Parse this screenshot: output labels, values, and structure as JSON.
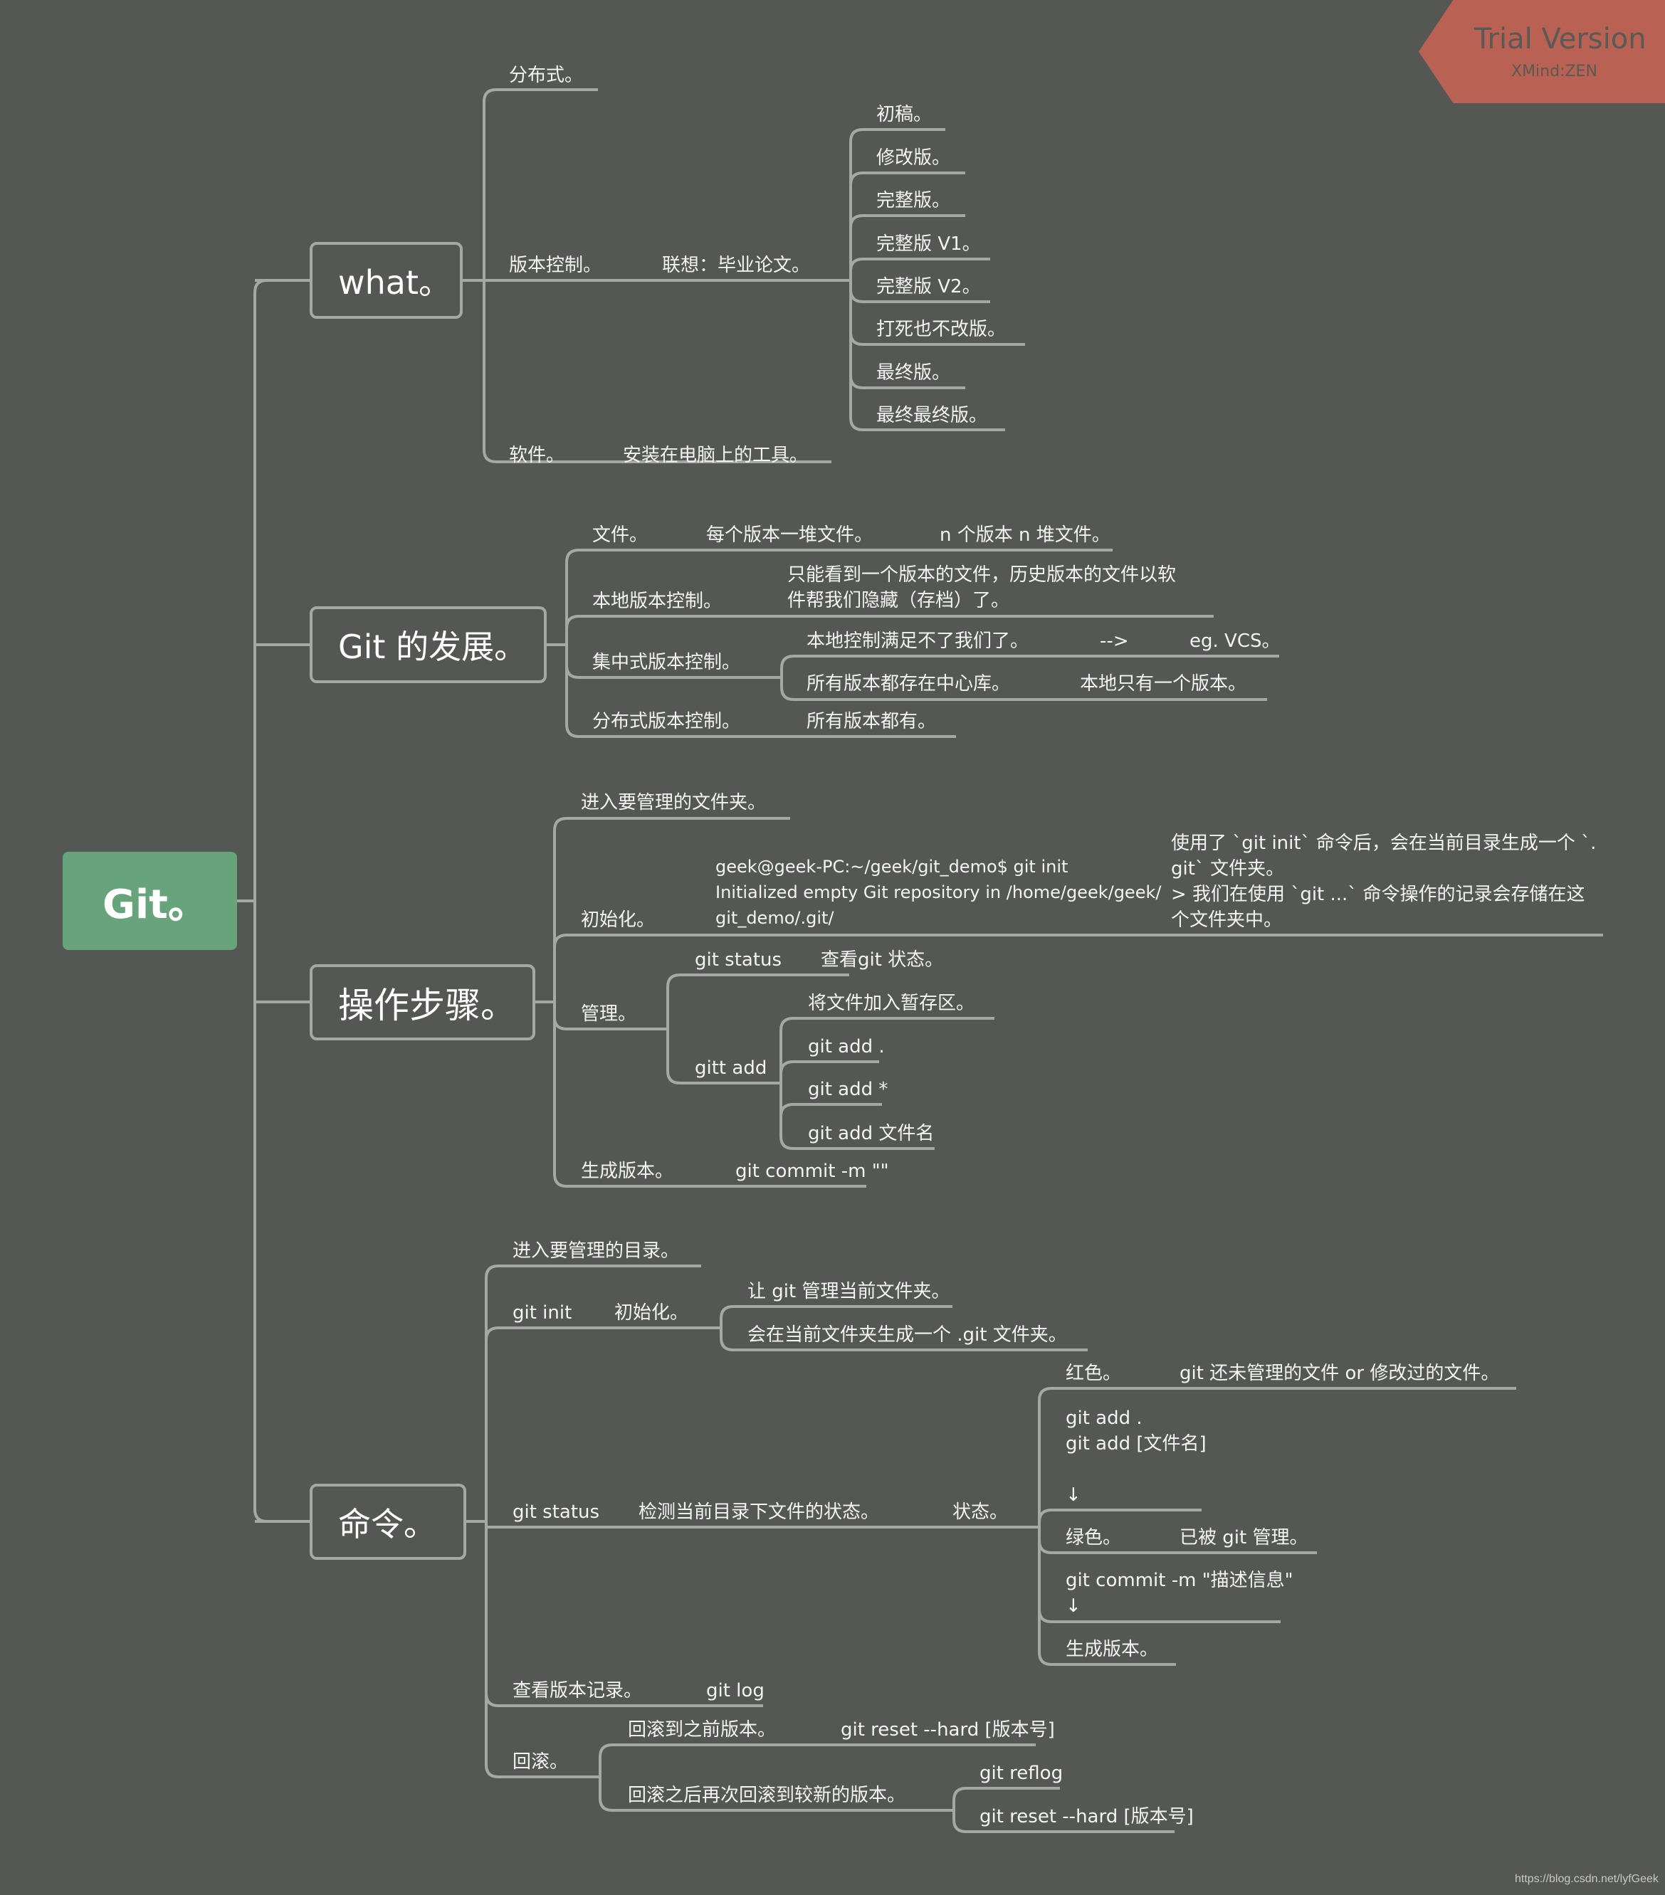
{
  "badge": {
    "title": "Trial Version",
    "subtitle": "XMind:ZEN",
    "color": "#b96152"
  },
  "watermark": "https://blog.csdn.net/lyfGeek",
  "colors": {
    "background": "#555754",
    "root": "#67a47b",
    "line": "#a5a9a3",
    "text": "#f4f4f4"
  },
  "root": {
    "label": "Git。"
  },
  "what": {
    "label": "what。",
    "distributed": "分布式。",
    "vcs": "版本控制。",
    "analogy": "联想：毕业论文。",
    "versions": [
      "初稿。",
      "修改版。",
      "完整版。",
      "完整版 V1。",
      "完整版 V2。",
      "打死也不改版。",
      "最终版。",
      "最终最终版。"
    ],
    "software": "软件。",
    "software_desc": "安装在电脑上的工具。"
  },
  "history": {
    "label": "Git 的发展。",
    "file": "文件。",
    "file_desc1": "每个版本一堆文件。",
    "file_desc2": "n 个版本 n 堆文件。",
    "local": "本地版本控制。",
    "local_desc": "只能看到一个版本的文件，历史版本的文件以软\n件帮我们隐藏（存档）了。",
    "central": "集中式版本控制。",
    "central_desc1": "本地控制满足不了我们了。",
    "central_arrow": "-->",
    "central_eg": "eg. VCS。",
    "central_desc2": "所有版本都存在中心库。",
    "central_desc3": "本地只有一个版本。",
    "distributed": "分布式版本控制。",
    "distributed_desc": "所有版本都有。"
  },
  "steps": {
    "label": "操作步骤。",
    "enter": "进入要管理的文件夹。",
    "init": "初始化。",
    "init_console": "geek@geek-PC:~/geek/git_demo$ git init\nInitialized empty Git repository in /home/geek/geek/\ngit_demo/.git/",
    "init_note": "使用了 `git init` 命令后，会在当前目录生成一个 `.\ngit` 文件夹。\n> 我们在使用 `git ...` 命令操作的记录会存储在这\n个文件夹中。",
    "manage": "管理。",
    "git_status": "git status",
    "git_status_desc": "查看git 状态。",
    "gitt_add": "gitt add",
    "add_desc": "将文件加入暂存区。",
    "add_variants": [
      "git add .",
      "git add *",
      "git add 文件名"
    ],
    "commit": "生成版本。",
    "commit_cmd": "git commit -m \"\""
  },
  "commands": {
    "label": "命令。",
    "enter": "进入要管理的目录。",
    "git_init": "git init",
    "init": "初始化。",
    "init_desc1": "让 git 管理当前文件夹。",
    "init_desc2": "会在当前文件夹生成一个 .git 文件夹。",
    "git_status": "git status",
    "status_desc": "检测当前目录下文件的状态。",
    "state": "状态。",
    "red": "红色。",
    "red_desc": "git 还未管理的文件 or 修改过的文件。",
    "add_steps": "git add .\ngit add [文件名]\n\n↓",
    "green": "绿色。",
    "green_desc": "已被 git 管理。",
    "commit_steps": "git commit -m \"描述信息\"\n↓",
    "version": "生成版本。",
    "log": "查看版本记录。",
    "log_cmd": "git log",
    "rollback": "回滚。",
    "rollback_prev": "回滚到之前版本。",
    "rollback_prev_cmd": "git reset --hard [版本号]",
    "rollback_newer": "回滚之后再次回滚到较新的版本。",
    "reflog": "git reflog",
    "rollback_newer_cmd": "git reset --hard [版本号]"
  }
}
